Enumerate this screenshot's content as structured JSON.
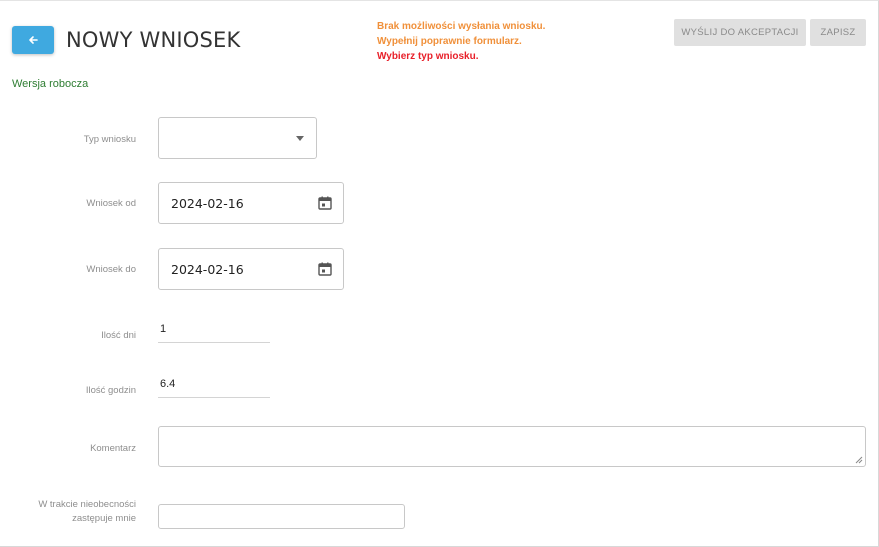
{
  "header": {
    "back_icon": "arrow-left-icon",
    "title": "NOWY WNIOSEK",
    "status": "Wersja robocza"
  },
  "warnings": [
    "Brak możliwości wysłania wniosku.",
    "Wypełnij poprawnie formularz.",
    "Wybierz typ wniosku."
  ],
  "colors": {
    "accent": "#3fa9e0",
    "warning": "#f0903a",
    "error": "#e8202a",
    "status": "#2e7d32"
  },
  "toolbar": {
    "send_label": "WYŚLIJ DO AKCEPTACJI",
    "save_label": "ZAPISZ"
  },
  "form": {
    "type": {
      "label": "Typ wniosku",
      "value": ""
    },
    "date_from": {
      "label": "Wniosek od",
      "value": "2024-02-16",
      "icon": "calendar-icon"
    },
    "date_to": {
      "label": "Wniosek do",
      "value": "2024-02-16",
      "icon": "calendar-icon"
    },
    "days": {
      "label": "Ilość dni",
      "value": "1"
    },
    "hours": {
      "label": "Ilość godzin",
      "value": "6.4"
    },
    "comment": {
      "label": "Komentarz",
      "value": ""
    },
    "substitute": {
      "label_line1": "W trakcie nieobecności",
      "label_line2": "zastępuje mnie",
      "value": ""
    }
  }
}
